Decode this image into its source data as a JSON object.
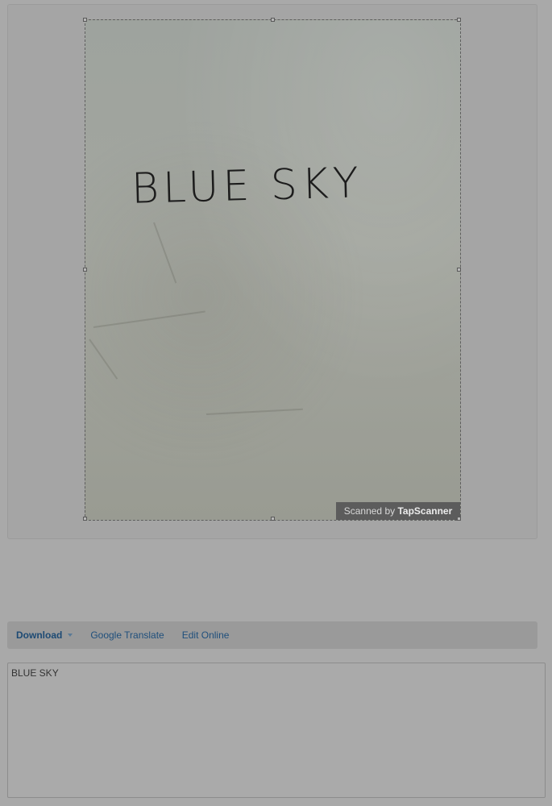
{
  "scan": {
    "handwritten_text": "BLUE SKY",
    "watermark_prefix": "Scanned by ",
    "watermark_brand": "TapScanner"
  },
  "toolbar": {
    "download_label": "Download",
    "translate_label": "Google Translate",
    "edit_label": "Edit Online"
  },
  "result": {
    "text": "BLUE SKY"
  },
  "colors": {
    "overlay": "#a9a9a9",
    "link": "#1f4f7c"
  }
}
